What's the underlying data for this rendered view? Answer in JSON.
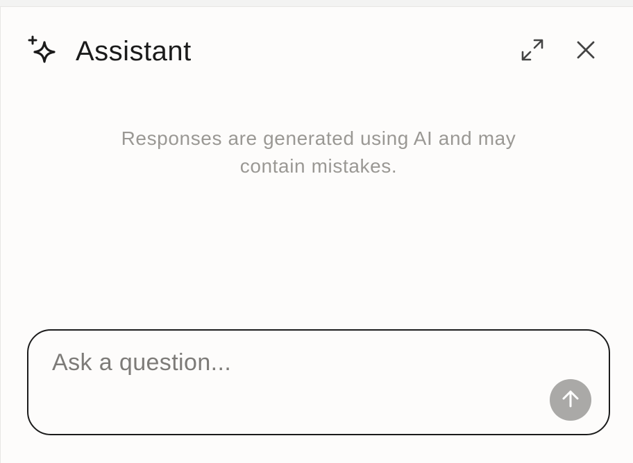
{
  "header": {
    "title": "Assistant",
    "icons": {
      "brand": "sparkle-icon",
      "expand": "expand-icon",
      "close": "close-icon"
    }
  },
  "main": {
    "disclaimer": "Responses are generated using AI and may contain mistakes."
  },
  "composer": {
    "value": "",
    "placeholder": "Ask a question...",
    "send_icon": "arrow-up-icon"
  },
  "colors": {
    "panel_bg": "#fdfcfb",
    "text": "#1b1b1b",
    "muted_text": "#9a9894",
    "send_button": "#aaa9a7"
  }
}
